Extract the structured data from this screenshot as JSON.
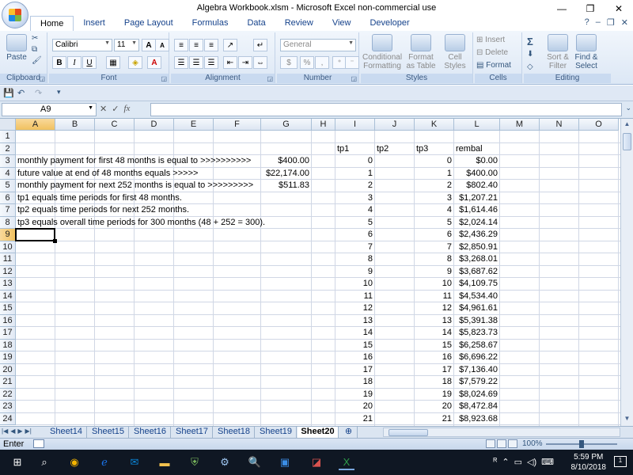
{
  "window": {
    "title": "Algebra Workbook.xlsm - Microsoft Excel non-commercial use",
    "controls": [
      "—",
      "❐",
      "✕"
    ]
  },
  "ribbon": {
    "tabs": [
      "Home",
      "Insert",
      "Page Layout",
      "Formulas",
      "Data",
      "Review",
      "View",
      "Developer"
    ],
    "active_tab": "Home",
    "groups": {
      "clipboard": {
        "label": "Clipboard",
        "paste": "Paste"
      },
      "font": {
        "label": "Font",
        "font_name": "Calibri",
        "font_size": "11",
        "bold": "B",
        "italic": "I",
        "underline": "U",
        "grow": "A",
        "shrink": "A"
      },
      "alignment": {
        "label": "Alignment"
      },
      "number": {
        "label": "Number",
        "format": "General",
        "currency": "$",
        "percent": "%",
        "comma": ","
      },
      "styles": {
        "label": "Styles",
        "conditional": "Conditional Formatting",
        "as_table": "Format as Table",
        "cell_styles": "Cell Styles"
      },
      "cells": {
        "label": "Cells",
        "insert": "Insert",
        "delete": "Delete",
        "format": "Format"
      },
      "editing": {
        "label": "Editing",
        "sort": "Sort & Filter",
        "find": "Find & Select",
        "sum": "Σ"
      }
    }
  },
  "formula_bar": {
    "name_box": "A9",
    "fx": "fx",
    "formula": ""
  },
  "grid": {
    "columns": [
      "A",
      "B",
      "C",
      "D",
      "E",
      "F",
      "G",
      "H",
      "I",
      "J",
      "K",
      "L",
      "M",
      "N",
      "O"
    ],
    "selected_column": "A",
    "selected_row": 9,
    "rows": [
      "1",
      "2",
      "3",
      "4",
      "5",
      "6",
      "7",
      "8",
      "9",
      "10",
      "11",
      "12",
      "13",
      "14",
      "15",
      "16",
      "17",
      "18",
      "19",
      "20",
      "21",
      "22",
      "23",
      "24"
    ],
    "text_cells": {
      "a3": "monthly payment for first 48 months is equal to >>>>>>>>>>",
      "a4": "future value at end of 48 months equals >>>>>",
      "a5": "monthly payment for next 252 months is equal to >>>>>>>>>",
      "a6": "tp1 equals time periods for first 48 months.",
      "a7": "tp2 equals time periods for next 252 months.",
      "a8": "tp3 equals overall time periods for 300 months (48 + 252 = 300).",
      "g3": "$400.00",
      "g4": "$22,174.00",
      "g5": "$511.83",
      "i2": "tp1",
      "j2": "tp2",
      "k2": "tp3",
      "l2": "rembal"
    },
    "tp1": [
      "0",
      "1",
      "2",
      "3",
      "4",
      "5",
      "6",
      "7",
      "8",
      "9",
      "10",
      "11",
      "12",
      "13",
      "14",
      "15",
      "16",
      "17",
      "18",
      "19",
      "20",
      "21"
    ],
    "tp3": [
      "0",
      "1",
      "2",
      "3",
      "4",
      "5",
      "6",
      "7",
      "8",
      "9",
      "10",
      "11",
      "12",
      "13",
      "14",
      "15",
      "16",
      "17",
      "18",
      "19",
      "20",
      "21"
    ],
    "rembal": [
      "$0.00",
      "$400.00",
      "$802.40",
      "$1,207.21",
      "$1,614.46",
      "$2,024.14",
      "$2,436.29",
      "$2,850.91",
      "$3,268.01",
      "$3,687.62",
      "$4,109.75",
      "$4,534.40",
      "$4,961.61",
      "$5,391.38",
      "$5,823.73",
      "$6,258.67",
      "$6,696.22",
      "$7,136.40",
      "$7,579.22",
      "$8,024.69",
      "$8,472.84",
      "$8,923.68"
    ]
  },
  "sheets": {
    "tabs": [
      "Sheet14",
      "Sheet15",
      "Sheet16",
      "Sheet17",
      "Sheet18",
      "Sheet19",
      "Sheet20"
    ],
    "active": "Sheet20"
  },
  "status": {
    "mode": "Enter",
    "zoom": "100%"
  },
  "taskbar": {
    "time": "5:59 PM",
    "date": "8/10/2018"
  }
}
